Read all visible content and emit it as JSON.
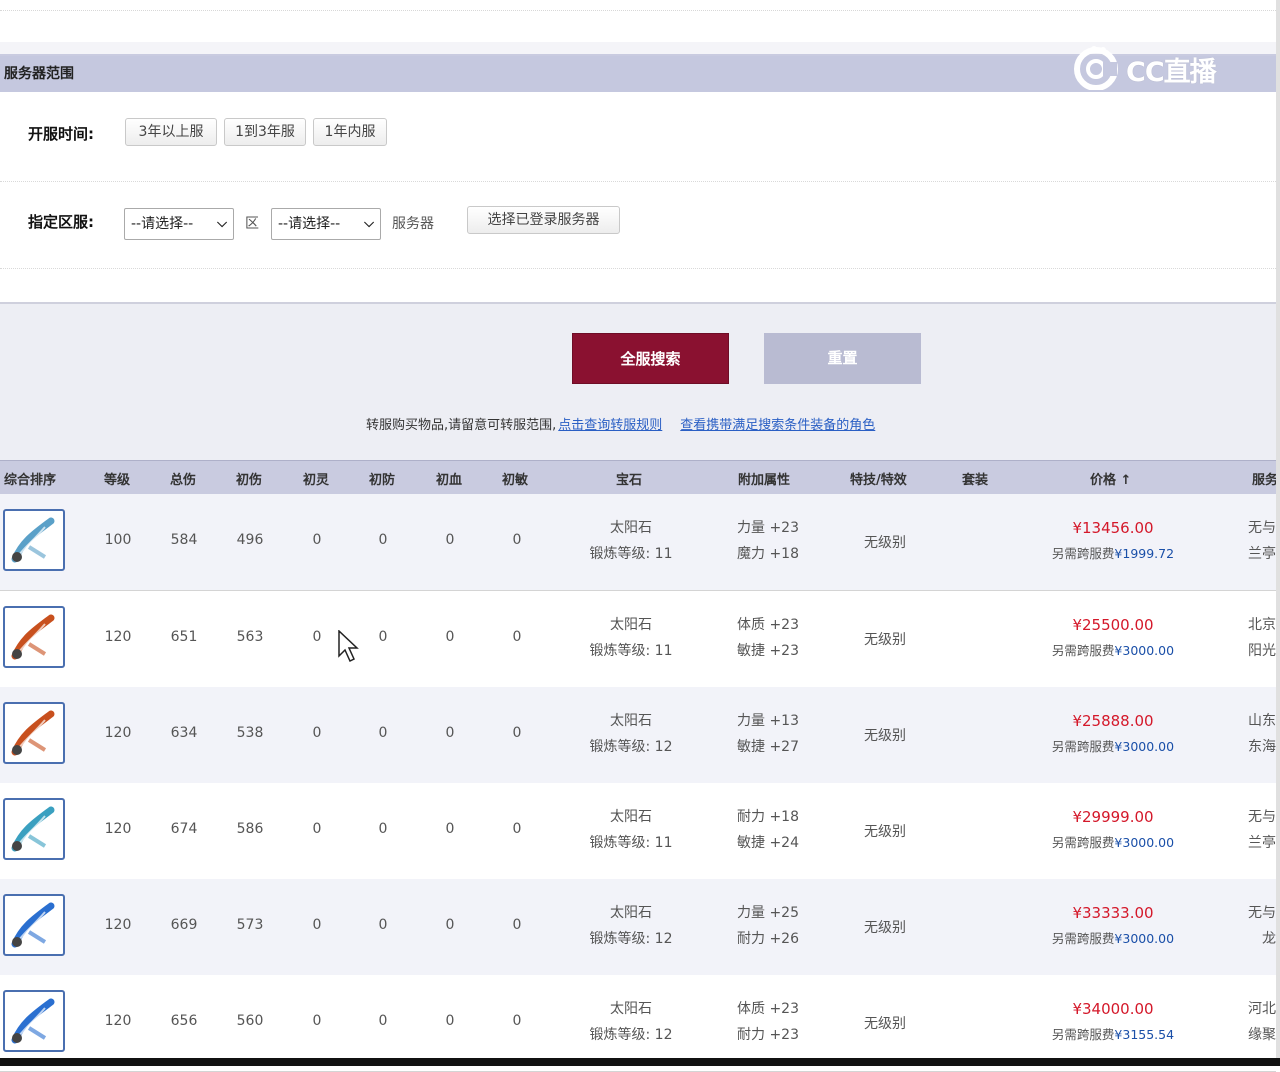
{
  "section": {
    "title": "服务器范围"
  },
  "logo": {
    "text": "CC直播"
  },
  "open_time": {
    "label": "开服时间:",
    "options": [
      "3年以上服",
      "1到3年服",
      "1年内服"
    ]
  },
  "region": {
    "label": "指定区服:",
    "select1": "--请选择--",
    "zone_text": "区",
    "select2": "--请选择--",
    "server_text": "服务器",
    "choose_button": "选择已登录服务器"
  },
  "actions": {
    "search": "全服搜索",
    "reset": "重置"
  },
  "notice": {
    "text": "转服购买物品,请留意可转服范围,",
    "link1": "点击查询转服规则",
    "link2": "查看携带满足搜索条件装备的角色"
  },
  "table": {
    "headers": [
      "综合排序",
      "等级",
      "总伤",
      "初伤",
      "初灵",
      "初防",
      "初血",
      "初敏",
      "宝石",
      "附加属性",
      "特技/特效",
      "套装",
      "价格 ↑",
      "服务"
    ],
    "rows": [
      {
        "level": "100",
        "total": "584",
        "init_dmg": "496",
        "ling": "0",
        "def": "0",
        "hp": "0",
        "agi": "0",
        "gem1": "太阳石",
        "gem2": "锻炼等级: 11",
        "attr1": "力量 +23",
        "attr2": "魔力 +18",
        "skill": "无级别",
        "price": "¥13456.00",
        "fee_label": "另需跨服费",
        "fee": "¥1999.72",
        "server1": "无与",
        "server2": "兰亭",
        "icon": "weapon-whip-icon",
        "color": "#5aa0c8"
      },
      {
        "level": "120",
        "total": "651",
        "init_dmg": "563",
        "ling": "0",
        "def": "0",
        "hp": "0",
        "agi": "0",
        "gem1": "太阳石",
        "gem2": "锻炼等级: 11",
        "attr1": "体质 +23",
        "attr2": "敏捷 +23",
        "skill": "无级别",
        "price": "¥25500.00",
        "fee_label": "另需跨服费",
        "fee": "¥3000.00",
        "server1": "北京",
        "server2": "阳光",
        "icon": "weapon-whip-icon",
        "color": "#c8501e"
      },
      {
        "level": "120",
        "total": "634",
        "init_dmg": "538",
        "ling": "0",
        "def": "0",
        "hp": "0",
        "agi": "0",
        "gem1": "太阳石",
        "gem2": "锻炼等级: 12",
        "attr1": "力量 +13",
        "attr2": "敏捷 +27",
        "skill": "无级别",
        "price": "¥25888.00",
        "fee_label": "另需跨服费",
        "fee": "¥3000.00",
        "server1": "山东",
        "server2": "东海",
        "icon": "weapon-whip-icon",
        "color": "#c8501e"
      },
      {
        "level": "120",
        "total": "674",
        "init_dmg": "586",
        "ling": "0",
        "def": "0",
        "hp": "0",
        "agi": "0",
        "gem1": "太阳石",
        "gem2": "锻炼等级: 11",
        "attr1": "耐力 +18",
        "attr2": "敏捷 +24",
        "skill": "无级别",
        "price": "¥29999.00",
        "fee_label": "另需跨服费",
        "fee": "¥3000.00",
        "server1": "无与",
        "server2": "兰亭",
        "icon": "weapon-whip-icon",
        "color": "#3aa0c0"
      },
      {
        "level": "120",
        "total": "669",
        "init_dmg": "573",
        "ling": "0",
        "def": "0",
        "hp": "0",
        "agi": "0",
        "gem1": "太阳石",
        "gem2": "锻炼等级: 12",
        "attr1": "力量 +25",
        "attr2": "耐力 +26",
        "skill": "无级别",
        "price": "¥33333.00",
        "fee_label": "另需跨服费",
        "fee": "¥3000.00",
        "server1": "无与",
        "server2": "龙",
        "icon": "weapon-whip-icon",
        "color": "#2a6fd0"
      },
      {
        "level": "120",
        "total": "656",
        "init_dmg": "560",
        "ling": "0",
        "def": "0",
        "hp": "0",
        "agi": "0",
        "gem1": "太阳石",
        "gem2": "锻炼等级: 12",
        "attr1": "体质 +23",
        "attr2": "耐力 +23",
        "skill": "无级别",
        "price": "¥34000.00",
        "fee_label": "另需跨服费",
        "fee": "¥3155.54",
        "server1": "河北",
        "server2": "缘聚",
        "icon": "weapon-whip-icon",
        "color": "#2a6fd0"
      }
    ]
  }
}
